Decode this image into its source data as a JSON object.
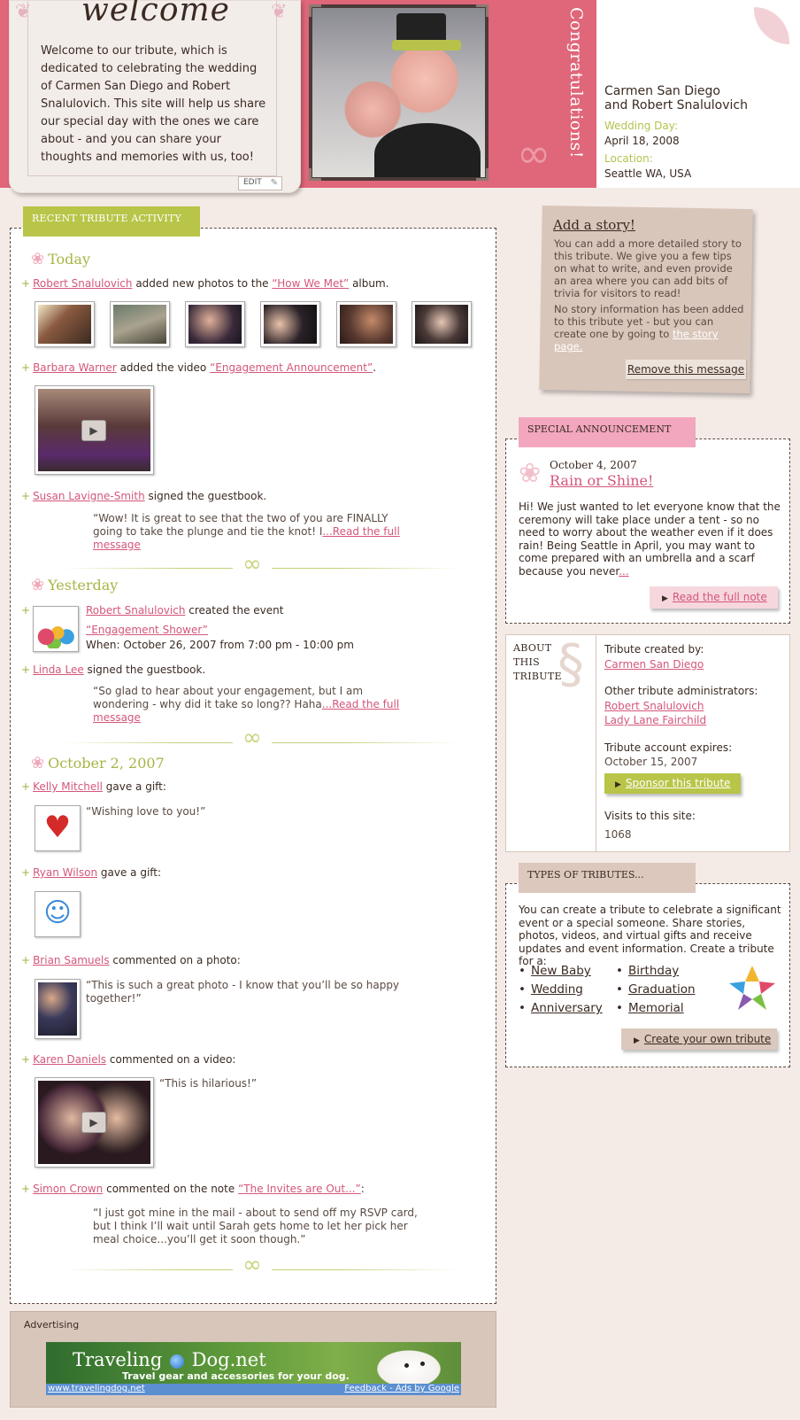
{
  "header": {
    "welcome_title": "welcome",
    "welcome_text": "Welcome to our tribute, which is dedicated to celebrating the wedding of Carmen San Diego and Robert Snalulovich. This site will help us share our special day with the ones we care about - and you can share your thoughts and memories with us, too!",
    "edit_label": "EDIT",
    "congrats": "Congratulations!",
    "couple_line1": "Carmen San Diego",
    "couple_line2": "and Robert Snalulovich",
    "wedding_day_label": "Wedding Day:",
    "wedding_day": "April 18, 2008",
    "location_label": "Location:",
    "location": "Seattle WA, USA"
  },
  "activity": {
    "tab_label": "RECENT TRIBUTE ACTIVITY",
    "days": [
      "Today",
      "Yesterday",
      "October 2, 2007"
    ],
    "e1": {
      "user": "Robert Snalulovich",
      "text1": " added new photos to the ",
      "link": "“How We Met”",
      "text2": " album."
    },
    "e2": {
      "user": "Barbara Warner",
      "text1": " added the video ",
      "link": "“Engagement Announcement”",
      "text2": "."
    },
    "e3": {
      "user": "Susan Lavigne-Smith",
      "text1": " signed the guestbook.",
      "quote": "“Wow! It is great to see that the two of you are FINALLY going to take the plunge and tie the knot! I",
      "more": "...Read the full message"
    },
    "e4": {
      "user": "Robert Snalulovich",
      "text1": " created the event",
      "event": "“Engagement Shower”",
      "when": "When: October 26, 2007 from 7:00 pm - 10:00 pm"
    },
    "e5": {
      "user": "Linda Lee",
      "text1": " signed the guestbook.",
      "quote": "“So glad to hear about your engagement, but I am wondering - why did it take so long?? Haha",
      "more": "...Read the full message"
    },
    "e6": {
      "user": "Kelly Mitchell",
      "text1": " gave a gift:",
      "quote": "“Wishing love to you!”"
    },
    "e7": {
      "user": "Ryan Wilson",
      "text1": " gave a gift:"
    },
    "e8": {
      "user": "Brian Samuels",
      "text1": " commented on a photo:",
      "quote": "“This is such a great photo - I know that you’ll be so happy together!”"
    },
    "e9": {
      "user": "Karen Daniels",
      "text1": " commented on a video:",
      "quote": "“This is hilarious!”"
    },
    "e10": {
      "user": "Simon Crown",
      "text1": " commented on the note ",
      "link": "“The Invites are Out...”",
      "text2": ":",
      "quote": "“I just got mine in the mail - about to send off my RSVP card, but I think I’ll wait until Sarah gets home to let her pick her meal choice...you’ll get it soon though.”"
    }
  },
  "story": {
    "title": "Add a story!",
    "p1": "You can add a more detailed story to this tribute. We give you a few tips on what to write, and even provide an area where you can add bits of trivia for visitors to read!",
    "p2": "No story information has been added to this tribute yet - but you can create one by going to ",
    "p2_link": "the story page.",
    "remove": "Remove this message"
  },
  "announcement": {
    "tab_label": "SPECIAL ANNOUNCEMENT",
    "date": "October 4, 2007",
    "title": "Rain or Shine!",
    "text": "Hi! We just wanted to let everyone know that the ceremony will take place under a tent - so no need to worry about the weather even if it does rain! Being Seattle in April, you may want to come prepared with an umbrella and a scarf because you never",
    "more": "...",
    "read_btn": "Read the full note"
  },
  "about": {
    "title": "ABOUT THIS TRIBUTE",
    "created_label": "Tribute created by:",
    "created_by": "Carmen San Diego",
    "admins_label": "Other tribute administrators:",
    "admin1": "Robert Snalulovich",
    "admin2": "Lady Lane Fairchild",
    "expires_label": "Tribute account expires:",
    "expires": "October 15, 2007",
    "sponsor_btn": "Sponsor this tribute",
    "visits_label": "Visits to this site:",
    "visits": "1068"
  },
  "types": {
    "tab_label": "TYPES OF TRIBUTES...",
    "text": "You can create a tribute to celebrate a significant event or a special someone. Share stories, photos, videos, and virtual gifts and receive updates and event information. Create a tribute for a:",
    "col1": [
      "New Baby",
      "Wedding",
      "Anniversary"
    ],
    "col2": [
      "Birthday",
      "Graduation",
      "Memorial "
    ],
    "create_btn": "Create your own tribute"
  },
  "ad": {
    "label": "Advertising",
    "title_a": "Traveling",
    "title_b": "Dog.net",
    "sub": "Travel gear and accessories for your dog.",
    "url": "www.travelingdog.net",
    "feedback": "Feedback - Ads by Google"
  },
  "colors": {
    "accent_green": "#b8c548",
    "accent_pink": "#e0667a",
    "link": "#d4577a",
    "tan": "#d9c6bb"
  }
}
